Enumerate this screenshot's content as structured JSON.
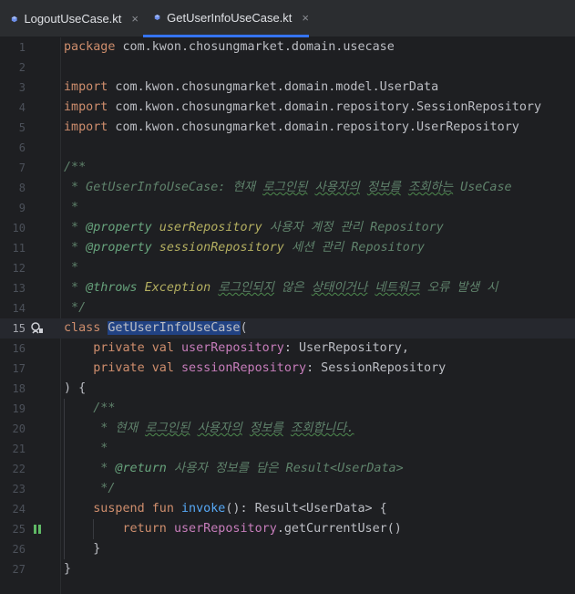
{
  "tabs": [
    {
      "label": "LogoutUseCase.kt",
      "active": false
    },
    {
      "label": "GetUserInfoUseCase.kt",
      "active": true
    }
  ],
  "close_glyph": "×",
  "colors": {
    "background": "#1e1f22",
    "tab_bar": "#2b2d30",
    "accent": "#3574f0",
    "kotlin_icon": "#6e8fea",
    "keyword": "#cf8e6d",
    "property": "#c77dbb",
    "function": "#56a8f5",
    "comment": "#5f826b"
  },
  "icons": {
    "tab": "kotlin-file-icon",
    "line_15": "implemented-class-icon",
    "line_25": "run-gutter-icon"
  },
  "current_line": 15,
  "lines": [
    {
      "n": "1",
      "t": [
        {
          "k": "kw",
          "s": "package"
        },
        {
          "s": " com.kwon.chosungmarket.domain.usecase"
        }
      ]
    },
    {
      "n": "2",
      "t": []
    },
    {
      "n": "3",
      "t": [
        {
          "k": "kw",
          "s": "import"
        },
        {
          "s": " com.kwon.chosungmarket.domain.model.UserData"
        }
      ]
    },
    {
      "n": "4",
      "t": [
        {
          "k": "kw",
          "s": "import"
        },
        {
          "s": " com.kwon.chosungmarket.domain.repository.SessionRepository"
        }
      ]
    },
    {
      "n": "5",
      "t": [
        {
          "k": "kw",
          "s": "import"
        },
        {
          "s": " com.kwon.chosungmarket.domain.repository.UserRepository"
        }
      ]
    },
    {
      "n": "6",
      "t": []
    },
    {
      "n": "7",
      "t": [
        {
          "k": "doc",
          "s": "/**"
        }
      ]
    },
    {
      "n": "8",
      "t": [
        {
          "k": "doc",
          "s": " * GetUserInfoUseCase: 현재 "
        },
        {
          "k": "doc squig",
          "s": "로그인된"
        },
        {
          "k": "doc",
          "s": " "
        },
        {
          "k": "doc squig",
          "s": "사용자의"
        },
        {
          "k": "doc",
          "s": " "
        },
        {
          "k": "doc squig",
          "s": "정보를"
        },
        {
          "k": "doc",
          "s": " "
        },
        {
          "k": "doc squig",
          "s": "조회하는"
        },
        {
          "k": "doc",
          "s": " UseCase"
        }
      ]
    },
    {
      "n": "9",
      "t": [
        {
          "k": "doc",
          "s": " *"
        }
      ]
    },
    {
      "n": "10",
      "t": [
        {
          "k": "doc",
          "s": " * "
        },
        {
          "k": "doctag",
          "s": "@property"
        },
        {
          "k": "dockw",
          "s": " userRepository"
        },
        {
          "k": "doc",
          "s": " 사용자 계정 관리 Repository"
        }
      ]
    },
    {
      "n": "11",
      "t": [
        {
          "k": "doc",
          "s": " * "
        },
        {
          "k": "doctag",
          "s": "@property"
        },
        {
          "k": "dockw",
          "s": " sessionRepository"
        },
        {
          "k": "doc",
          "s": " 세션 관리 Repository"
        }
      ]
    },
    {
      "n": "12",
      "t": [
        {
          "k": "doc",
          "s": " *"
        }
      ]
    },
    {
      "n": "13",
      "t": [
        {
          "k": "doc",
          "s": " * "
        },
        {
          "k": "doctag",
          "s": "@throws"
        },
        {
          "k": "dockw",
          "s": " Exception"
        },
        {
          "k": "doc",
          "s": " "
        },
        {
          "k": "doc squig",
          "s": "로그인되지"
        },
        {
          "k": "doc",
          "s": " 않은 "
        },
        {
          "k": "doc squig",
          "s": "상태이거나"
        },
        {
          "k": "doc",
          "s": " "
        },
        {
          "k": "doc squig",
          "s": "네트워크"
        },
        {
          "k": "doc",
          "s": " 오류 발생 시"
        }
      ]
    },
    {
      "n": "14",
      "t": [
        {
          "k": "doc",
          "s": " */"
        }
      ]
    },
    {
      "n": "15",
      "t": [
        {
          "k": "kw",
          "s": "class"
        },
        {
          "s": " "
        },
        {
          "k": "hl",
          "s": "GetUserInfoUseCase"
        },
        {
          "s": "("
        }
      ]
    },
    {
      "n": "16",
      "t": [
        {
          "s": "    "
        },
        {
          "k": "kw",
          "s": "private val"
        },
        {
          "s": " "
        },
        {
          "k": "prop",
          "s": "userRepository"
        },
        {
          "s": ": UserRepository,"
        }
      ]
    },
    {
      "n": "17",
      "t": [
        {
          "s": "    "
        },
        {
          "k": "kw",
          "s": "private val"
        },
        {
          "s": " "
        },
        {
          "k": "prop",
          "s": "sessionRepository"
        },
        {
          "s": ": SessionRepository"
        }
      ]
    },
    {
      "n": "18",
      "t": [
        {
          "s": ") {"
        }
      ]
    },
    {
      "n": "19",
      "t": [
        {
          "s": "    "
        },
        {
          "k": "doc",
          "s": "/**"
        }
      ]
    },
    {
      "n": "20",
      "t": [
        {
          "k": "doc",
          "s": "     * 현재 "
        },
        {
          "k": "doc squig",
          "s": "로그인된"
        },
        {
          "k": "doc",
          "s": " "
        },
        {
          "k": "doc squig",
          "s": "사용자의"
        },
        {
          "k": "doc",
          "s": " "
        },
        {
          "k": "doc squig",
          "s": "정보를"
        },
        {
          "k": "doc",
          "s": " "
        },
        {
          "k": "doc squig",
          "s": "조회합니다."
        }
      ]
    },
    {
      "n": "21",
      "t": [
        {
          "k": "doc",
          "s": "     *"
        }
      ]
    },
    {
      "n": "22",
      "t": [
        {
          "k": "doc",
          "s": "     * "
        },
        {
          "k": "doctag",
          "s": "@return"
        },
        {
          "k": "doc",
          "s": " 사용자 정보를 담은 Result<UserData>"
        }
      ]
    },
    {
      "n": "23",
      "t": [
        {
          "k": "doc",
          "s": "     */"
        }
      ]
    },
    {
      "n": "24",
      "t": [
        {
          "s": "    "
        },
        {
          "k": "kw",
          "s": "suspend fun"
        },
        {
          "s": " "
        },
        {
          "k": "fn",
          "s": "invoke"
        },
        {
          "s": "(): Result<UserData> {"
        }
      ]
    },
    {
      "n": "25",
      "t": [
        {
          "s": "        "
        },
        {
          "k": "kw",
          "s": "return"
        },
        {
          "s": " "
        },
        {
          "k": "prop",
          "s": "userRepository"
        },
        {
          "s": ".getCurrentUser()"
        }
      ]
    },
    {
      "n": "26",
      "t": [
        {
          "s": "    }"
        }
      ]
    },
    {
      "n": "27",
      "t": [
        {
          "s": "}"
        }
      ]
    }
  ]
}
